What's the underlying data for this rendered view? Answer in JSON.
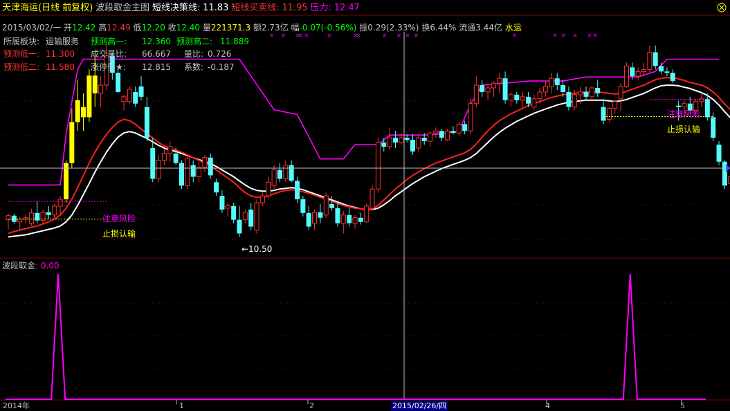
{
  "header": {
    "stock": "天津海运(日线 前复权)",
    "indicator": "波段取金主图",
    "line1_label": "短线决策线:",
    "line1_value": "11.83",
    "line2_label": "短线买卖线:",
    "line2_value": "11.95",
    "line3_label": "压力:",
    "line3_value": "12.47"
  },
  "quote": {
    "date": "2015/03/02/一",
    "open_label": "开",
    "open": "12.42",
    "high_label": "高",
    "high": "12.49",
    "low_label": "低",
    "low": "12.20",
    "close_label": "收",
    "close": "12.40",
    "vol_label": "量",
    "vol": "221371.3",
    "amount_label": "额",
    "amount": "2.73亿",
    "change_label": "幅",
    "change": "-0.07(-0.56%)",
    "amp_label": "振",
    "amp": "0.29(2.33%)",
    "turnover_label": "换",
    "turnover": "6.44%",
    "float_label": "流通",
    "float": "3.44亿",
    "sector": "水运"
  },
  "info": {
    "board_label": "所属板块:",
    "board": "运输服务",
    "pred_high1_label": "预测高一:",
    "pred_high1": "12.360",
    "pred_high2_label": "预测高二:",
    "pred_high2": "11.889",
    "pred_low1_label": "预测低一:",
    "pred_low1": "11.300",
    "deal_label": "成交量比:",
    "deal": "66.667",
    "volratio_label": "量比:",
    "volratio": "0.726",
    "pred_low2_label": "预测低二:",
    "pred_low2": "11.580",
    "limit_label": "涨停价★:",
    "limit": "12.815",
    "coef_label": "系数:",
    "coef": "-0.187"
  },
  "annotations": {
    "risk": "注意风险",
    "stoploss": "止损认输",
    "low_marker": "←10.50"
  },
  "sub": {
    "title": "波段取金",
    "value": ": 0.00"
  },
  "xaxis": {
    "labels": [
      "2014年",
      "1",
      "2",
      "2015/02/26/四",
      "4",
      "5"
    ]
  },
  "colors": {
    "up": "#ff3232",
    "down": "#54fcfc",
    "signal": "#ffff00",
    "ma_fast": "#ff2020",
    "ma_slow": "#ffffff",
    "pressure": "#ff00ff",
    "risk": "#ff00ff",
    "stoploss": "#ffff00",
    "grid": "#800000"
  },
  "chart_data": {
    "type": "candlestick",
    "price_range": [
      10.2,
      13.5
    ],
    "candles": [
      {
        "o": 10.75,
        "h": 10.84,
        "l": 10.61,
        "c": 10.81
      },
      {
        "o": 10.81,
        "h": 10.84,
        "l": 10.69,
        "c": 10.72
      },
      {
        "o": 10.72,
        "h": 10.79,
        "l": 10.61,
        "c": 10.76
      },
      {
        "o": 10.76,
        "h": 10.82,
        "l": 10.7,
        "c": 10.78
      },
      {
        "o": 10.7,
        "h": 10.91,
        "l": 10.66,
        "c": 10.85
      },
      {
        "o": 10.85,
        "h": 11.02,
        "l": 10.7,
        "c": 10.74
      },
      {
        "o": 10.74,
        "h": 10.9,
        "l": 10.7,
        "c": 10.86
      },
      {
        "o": 10.86,
        "h": 10.95,
        "l": 10.76,
        "c": 10.82
      },
      {
        "o": 10.82,
        "h": 10.98,
        "l": 10.78,
        "c": 10.95
      },
      {
        "o": 10.95,
        "h": 11.1,
        "l": 10.82,
        "c": 11.05
      },
      {
        "o": 11.05,
        "h": 11.62,
        "l": 11.0,
        "c": 11.58,
        "s": 1
      },
      {
        "o": 11.58,
        "h": 12.38,
        "l": 11.5,
        "c": 12.18,
        "s": 1
      },
      {
        "o": 12.18,
        "h": 12.8,
        "l": 12.05,
        "c": 12.5,
        "s": 1
      },
      {
        "o": 12.4,
        "h": 12.6,
        "l": 12.05,
        "c": 12.25,
        "s": 1
      },
      {
        "o": 12.25,
        "h": 12.95,
        "l": 12.18,
        "c": 12.86,
        "s": 1
      },
      {
        "o": 12.86,
        "h": 13.15,
        "l": 12.4,
        "c": 12.6,
        "s": 1
      },
      {
        "o": 12.6,
        "h": 12.85,
        "l": 12.4,
        "c": 12.72
      },
      {
        "o": 12.72,
        "h": 13.3,
        "l": 12.65,
        "c": 13.15
      },
      {
        "o": 13.15,
        "h": 13.2,
        "l": 12.8,
        "c": 12.9
      },
      {
        "o": 12.9,
        "h": 12.95,
        "l": 12.6,
        "c": 12.62
      },
      {
        "o": 12.48,
        "h": 12.58,
        "l": 12.35,
        "c": 12.55
      },
      {
        "o": 12.48,
        "h": 12.7,
        "l": 12.45,
        "c": 12.66
      },
      {
        "o": 12.62,
        "h": 12.7,
        "l": 12.4,
        "c": 12.45
      },
      {
        "o": 12.7,
        "h": 12.85,
        "l": 12.5,
        "c": 12.55
      },
      {
        "o": 12.4,
        "h": 12.55,
        "l": 11.9,
        "c": 11.95
      },
      {
        "o": 11.8,
        "h": 11.95,
        "l": 11.3,
        "c": 11.35
      },
      {
        "o": 11.35,
        "h": 11.7,
        "l": 11.3,
        "c": 11.62
      },
      {
        "o": 11.62,
        "h": 11.78,
        "l": 11.55,
        "c": 11.72
      },
      {
        "o": 11.72,
        "h": 11.9,
        "l": 11.6,
        "c": 11.82
      },
      {
        "o": 11.72,
        "h": 11.8,
        "l": 11.55,
        "c": 11.58
      },
      {
        "o": 11.58,
        "h": 11.62,
        "l": 11.2,
        "c": 11.25
      },
      {
        "o": 11.25,
        "h": 11.7,
        "l": 11.2,
        "c": 11.65
      },
      {
        "o": 11.55,
        "h": 11.62,
        "l": 11.3,
        "c": 11.38
      },
      {
        "o": 11.38,
        "h": 11.6,
        "l": 11.3,
        "c": 11.52
      },
      {
        "o": 11.52,
        "h": 11.7,
        "l": 11.45,
        "c": 11.66
      },
      {
        "o": 11.66,
        "h": 11.72,
        "l": 11.35,
        "c": 11.4
      },
      {
        "o": 11.3,
        "h": 11.35,
        "l": 11.1,
        "c": 11.15
      },
      {
        "o": 11.1,
        "h": 11.18,
        "l": 10.85,
        "c": 10.9
      },
      {
        "o": 10.92,
        "h": 11.0,
        "l": 10.8,
        "c": 10.96
      },
      {
        "o": 10.95,
        "h": 11.0,
        "l": 10.7,
        "c": 10.75
      },
      {
        "o": 10.75,
        "h": 10.95,
        "l": 10.5,
        "c": 10.55
      },
      {
        "o": 10.75,
        "h": 10.9,
        "l": 10.7,
        "c": 10.86
      },
      {
        "o": 10.9,
        "h": 11.0,
        "l": 10.6,
        "c": 10.65
      },
      {
        "o": 10.6,
        "h": 11.05,
        "l": 10.55,
        "c": 11.0
      },
      {
        "o": 11.0,
        "h": 11.15,
        "l": 10.95,
        "c": 11.1
      },
      {
        "o": 11.1,
        "h": 11.38,
        "l": 11.05,
        "c": 11.3
      },
      {
        "o": 11.25,
        "h": 11.55,
        "l": 11.2,
        "c": 11.48
      },
      {
        "o": 11.48,
        "h": 11.58,
        "l": 11.3,
        "c": 11.35
      },
      {
        "o": 11.35,
        "h": 11.62,
        "l": 11.3,
        "c": 11.55
      },
      {
        "o": 11.55,
        "h": 11.62,
        "l": 11.3,
        "c": 11.32
      },
      {
        "o": 11.32,
        "h": 11.38,
        "l": 11.0,
        "c": 11.05
      },
      {
        "o": 11.05,
        "h": 11.1,
        "l": 10.8,
        "c": 10.85
      },
      {
        "o": 10.85,
        "h": 10.95,
        "l": 10.6,
        "c": 10.65
      },
      {
        "o": 10.7,
        "h": 10.9,
        "l": 10.6,
        "c": 10.86
      },
      {
        "o": 10.86,
        "h": 10.98,
        "l": 10.7,
        "c": 10.78
      },
      {
        "o": 10.82,
        "h": 11.15,
        "l": 10.78,
        "c": 11.1
      },
      {
        "o": 10.98,
        "h": 11.1,
        "l": 10.88,
        "c": 10.92
      },
      {
        "o": 10.92,
        "h": 11.0,
        "l": 10.65,
        "c": 10.7
      },
      {
        "o": 10.7,
        "h": 10.88,
        "l": 10.55,
        "c": 10.82
      },
      {
        "o": 10.82,
        "h": 10.92,
        "l": 10.65,
        "c": 10.7
      },
      {
        "o": 10.7,
        "h": 10.82,
        "l": 10.62,
        "c": 10.78
      },
      {
        "o": 10.78,
        "h": 10.85,
        "l": 10.68,
        "c": 10.72
      },
      {
        "o": 10.72,
        "h": 10.98,
        "l": 10.7,
        "c": 10.95
      },
      {
        "o": 10.92,
        "h": 11.25,
        "l": 10.9,
        "c": 11.2
      },
      {
        "o": 11.2,
        "h": 11.95,
        "l": 11.15,
        "c": 11.88
      },
      {
        "o": 11.88,
        "h": 11.95,
        "l": 11.75,
        "c": 11.82
      },
      {
        "o": 11.82,
        "h": 12.1,
        "l": 11.78,
        "c": 11.95
      },
      {
        "o": 11.95,
        "h": 12.05,
        "l": 11.8,
        "c": 11.88
      },
      {
        "o": 11.88,
        "h": 12.02,
        "l": 11.85,
        "c": 11.95
      },
      {
        "o": 11.95,
        "h": 12.0,
        "l": 11.88,
        "c": 11.92
      },
      {
        "o": 11.92,
        "h": 12.0,
        "l": 11.7,
        "c": 11.75
      },
      {
        "o": 11.8,
        "h": 11.98,
        "l": 11.75,
        "c": 11.95
      },
      {
        "o": 11.95,
        "h": 12.02,
        "l": 11.85,
        "c": 11.9
      },
      {
        "o": 11.9,
        "h": 12.05,
        "l": 11.82,
        "c": 12.02
      },
      {
        "o": 12.02,
        "h": 12.1,
        "l": 11.95,
        "c": 12.05
      },
      {
        "o": 12.05,
        "h": 12.08,
        "l": 11.9,
        "c": 11.95
      },
      {
        "o": 11.92,
        "h": 12.08,
        "l": 11.9,
        "c": 12.05
      },
      {
        "o": 12.05,
        "h": 12.12,
        "l": 12.0,
        "c": 12.02
      },
      {
        "o": 12.02,
        "h": 12.18,
        "l": 11.98,
        "c": 12.15
      },
      {
        "o": 12.15,
        "h": 12.2,
        "l": 12.0,
        "c": 12.05
      },
      {
        "o": 12.05,
        "h": 12.52,
        "l": 12.0,
        "c": 12.45
      },
      {
        "o": 12.45,
        "h": 12.85,
        "l": 12.4,
        "c": 12.72
      },
      {
        "o": 12.72,
        "h": 12.8,
        "l": 12.55,
        "c": 12.62
      },
      {
        "o": 12.62,
        "h": 12.72,
        "l": 12.5,
        "c": 12.68
      },
      {
        "o": 12.68,
        "h": 12.78,
        "l": 12.55,
        "c": 12.75
      },
      {
        "o": 12.75,
        "h": 12.9,
        "l": 12.6,
        "c": 12.82
      },
      {
        "o": 12.82,
        "h": 12.92,
        "l": 12.45,
        "c": 12.5
      },
      {
        "o": 12.5,
        "h": 12.62,
        "l": 12.4,
        "c": 12.58
      },
      {
        "o": 12.58,
        "h": 12.62,
        "l": 12.45,
        "c": 12.5
      },
      {
        "o": 12.5,
        "h": 12.62,
        "l": 12.4,
        "c": 12.55
      },
      {
        "o": 12.55,
        "h": 12.62,
        "l": 12.4,
        "c": 12.45
      },
      {
        "o": 12.4,
        "h": 12.58,
        "l": 12.35,
        "c": 12.52
      },
      {
        "o": 12.52,
        "h": 12.68,
        "l": 12.45,
        "c": 12.62
      },
      {
        "o": 12.62,
        "h": 12.78,
        "l": 12.55,
        "c": 12.7
      },
      {
        "o": 12.7,
        "h": 12.9,
        "l": 12.6,
        "c": 12.82
      },
      {
        "o": 12.82,
        "h": 12.9,
        "l": 12.65,
        "c": 12.72
      },
      {
        "o": 12.72,
        "h": 12.8,
        "l": 12.55,
        "c": 12.62
      },
      {
        "o": 12.62,
        "h": 12.7,
        "l": 12.35,
        "c": 12.4
      },
      {
        "o": 12.4,
        "h": 12.65,
        "l": 12.35,
        "c": 12.58
      },
      {
        "o": 12.58,
        "h": 12.7,
        "l": 12.45,
        "c": 12.62
      },
      {
        "o": 12.62,
        "h": 12.7,
        "l": 12.5,
        "c": 12.55
      },
      {
        "o": 12.55,
        "h": 12.7,
        "l": 12.5,
        "c": 12.68
      },
      {
        "o": 12.68,
        "h": 12.8,
        "l": 12.55,
        "c": 12.6
      },
      {
        "o": 12.4,
        "h": 12.52,
        "l": 12.15,
        "c": 12.2
      },
      {
        "o": 12.22,
        "h": 12.4,
        "l": 12.18,
        "c": 12.38
      },
      {
        "o": 12.38,
        "h": 12.5,
        "l": 12.3,
        "c": 12.48
      },
      {
        "o": 12.52,
        "h": 12.75,
        "l": 12.35,
        "c": 12.7
      },
      {
        "o": 12.7,
        "h": 13.05,
        "l": 12.68,
        "c": 13.0
      },
      {
        "o": 12.98,
        "h": 13.05,
        "l": 12.8,
        "c": 12.85
      },
      {
        "o": 12.85,
        "h": 12.98,
        "l": 12.8,
        "c": 12.92
      },
      {
        "o": 12.92,
        "h": 13.05,
        "l": 12.85,
        "c": 12.95
      },
      {
        "o": 12.95,
        "h": 13.3,
        "l": 12.9,
        "c": 13.2
      },
      {
        "o": 13.2,
        "h": 13.3,
        "l": 12.95,
        "c": 13.0
      },
      {
        "o": 13.0,
        "h": 13.05,
        "l": 12.88,
        "c": 12.92
      },
      {
        "o": 12.92,
        "h": 12.98,
        "l": 12.85,
        "c": 12.9
      },
      {
        "o": 12.9,
        "h": 12.95,
        "l": 12.75,
        "c": 12.78
      },
      {
        "o": 12.42,
        "h": 12.49,
        "l": 12.2,
        "c": 12.4
      },
      {
        "o": 12.4,
        "h": 12.5,
        "l": 12.25,
        "c": 12.45
      },
      {
        "o": 12.45,
        "h": 12.55,
        "l": 12.3,
        "c": 12.35
      },
      {
        "o": 12.35,
        "h": 12.52,
        "l": 12.28,
        "c": 12.48
      },
      {
        "o": 12.48,
        "h": 12.6,
        "l": 12.4,
        "c": 12.52
      },
      {
        "o": 12.52,
        "h": 12.6,
        "l": 12.2,
        "c": 12.25
      },
      {
        "o": 12.25,
        "h": 12.32,
        "l": 11.9,
        "c": 11.95
      },
      {
        "o": 11.85,
        "h": 11.9,
        "l": 11.55,
        "c": 11.6
      },
      {
        "o": 11.6,
        "h": 11.62,
        "l": 11.2,
        "c": 11.25
      },
      {
        "o": 11.28,
        "h": 11.42,
        "l": 11.2,
        "c": 11.38
      }
    ],
    "ma_fast": [
      10.55,
      10.58,
      10.6,
      10.62,
      10.64,
      10.66,
      10.69,
      10.72,
      10.76,
      10.82,
      10.92,
      11.05,
      11.22,
      11.4,
      11.58,
      11.74,
      11.88,
      12.0,
      12.1,
      12.18,
      12.22,
      12.2,
      12.15,
      12.08,
      12.01,
      11.95,
      11.88,
      11.83,
      11.8,
      11.77,
      11.74,
      11.7,
      11.66,
      11.62,
      11.58,
      11.54,
      11.48,
      11.42,
      11.36,
      11.3,
      11.22,
      11.15,
      11.1,
      11.08,
      11.08,
      11.1,
      11.13,
      11.16,
      11.18,
      11.19,
      11.18,
      11.16,
      11.14,
      11.11,
      11.08,
      11.05,
      11.02,
      10.99,
      10.96,
      10.94,
      10.92,
      10.91,
      10.9,
      10.91,
      10.96,
      11.04,
      11.12,
      11.2,
      11.27,
      11.34,
      11.4,
      11.45,
      11.5,
      11.54,
      11.58,
      11.61,
      11.64,
      11.67,
      11.7,
      11.73,
      11.78,
      11.86,
      11.96,
      12.05,
      12.13,
      12.2,
      12.25,
      12.3,
      12.34,
      12.38,
      12.42,
      12.45,
      12.48,
      12.51,
      12.54,
      12.56,
      12.58,
      12.59,
      12.6,
      12.61,
      12.62,
      12.62,
      12.62,
      12.61,
      12.6,
      12.59,
      12.6,
      12.63,
      12.66,
      12.69,
      12.72,
      12.76,
      12.8,
      12.82,
      12.83,
      12.83,
      12.81,
      12.79,
      12.76,
      12.74,
      12.72,
      12.68,
      12.62,
      12.54,
      12.44,
      12.36
    ],
    "ma_slow": [
      10.5,
      10.51,
      10.52,
      10.53,
      10.55,
      10.57,
      10.59,
      10.61,
      10.63,
      10.66,
      10.72,
      10.82,
      10.96,
      11.12,
      11.28,
      11.45,
      11.6,
      11.74,
      11.86,
      11.96,
      12.02,
      12.04,
      12.02,
      11.98,
      11.94,
      11.89,
      11.84,
      11.8,
      11.77,
      11.75,
      11.72,
      11.69,
      11.66,
      11.63,
      11.6,
      11.57,
      11.53,
      11.48,
      11.43,
      11.38,
      11.32,
      11.26,
      11.21,
      11.18,
      11.17,
      11.17,
      11.18,
      11.2,
      11.21,
      11.22,
      11.21,
      11.19,
      11.16,
      11.13,
      11.1,
      11.07,
      11.04,
      11.01,
      10.98,
      10.95,
      10.93,
      10.91,
      10.9,
      10.9,
      10.92,
      10.97,
      11.03,
      11.1,
      11.16,
      11.22,
      11.28,
      11.33,
      11.38,
      11.42,
      11.46,
      11.5,
      11.53,
      11.56,
      11.59,
      11.62,
      11.66,
      11.72,
      11.8,
      11.88,
      11.96,
      12.03,
      12.09,
      12.14,
      12.19,
      12.23,
      12.27,
      12.31,
      12.34,
      12.37,
      12.4,
      12.43,
      12.45,
      12.47,
      12.48,
      12.49,
      12.5,
      12.5,
      12.5,
      12.5,
      12.49,
      12.48,
      12.49,
      12.51,
      12.54,
      12.57,
      12.6,
      12.64,
      12.68,
      12.71,
      12.72,
      12.72,
      12.71,
      12.69,
      12.67,
      12.64,
      12.61,
      12.57,
      12.51,
      12.43,
      12.33,
      12.24
    ],
    "pressure": [
      [
        0,
        11.26
      ],
      [
        9,
        11.26
      ],
      [
        10,
        12.0
      ],
      [
        12,
        12.95
      ],
      [
        13,
        13.1
      ],
      [
        40,
        13.1
      ],
      [
        46,
        12.36
      ],
      [
        50,
        12.29
      ],
      [
        54,
        11.64
      ],
      [
        58,
        11.64
      ],
      [
        60,
        11.85
      ],
      [
        64,
        11.85
      ],
      [
        66,
        11.99
      ],
      [
        72,
        11.99
      ],
      [
        74,
        12.0
      ],
      [
        78,
        12.05
      ],
      [
        80,
        12.44
      ],
      [
        82,
        12.72
      ],
      [
        90,
        12.78
      ],
      [
        96,
        12.78
      ],
      [
        100,
        12.84
      ],
      [
        109,
        12.84
      ],
      [
        112,
        12.92
      ],
      [
        114,
        13.1
      ],
      [
        123,
        13.1
      ]
    ],
    "risk_lines": [
      {
        "from": 0,
        "to": 17,
        "y": 11.02
      },
      {
        "from": 111,
        "to": 122,
        "y": 12.51
      }
    ],
    "stop_lines": [
      {
        "from": 0,
        "to": 17,
        "y": 10.76
      },
      {
        "from": 103,
        "to": 122,
        "y": 12.26
      }
    ],
    "markers_x": [
      91,
      95,
      100,
      101,
      103,
      111,
      120,
      121,
      130,
      135,
      138,
      141,
      175,
      189,
      192,
      196,
      201,
      203
    ],
    "sub_title": "波段取金",
    "sub_pulses": [
      9,
      108
    ]
  }
}
